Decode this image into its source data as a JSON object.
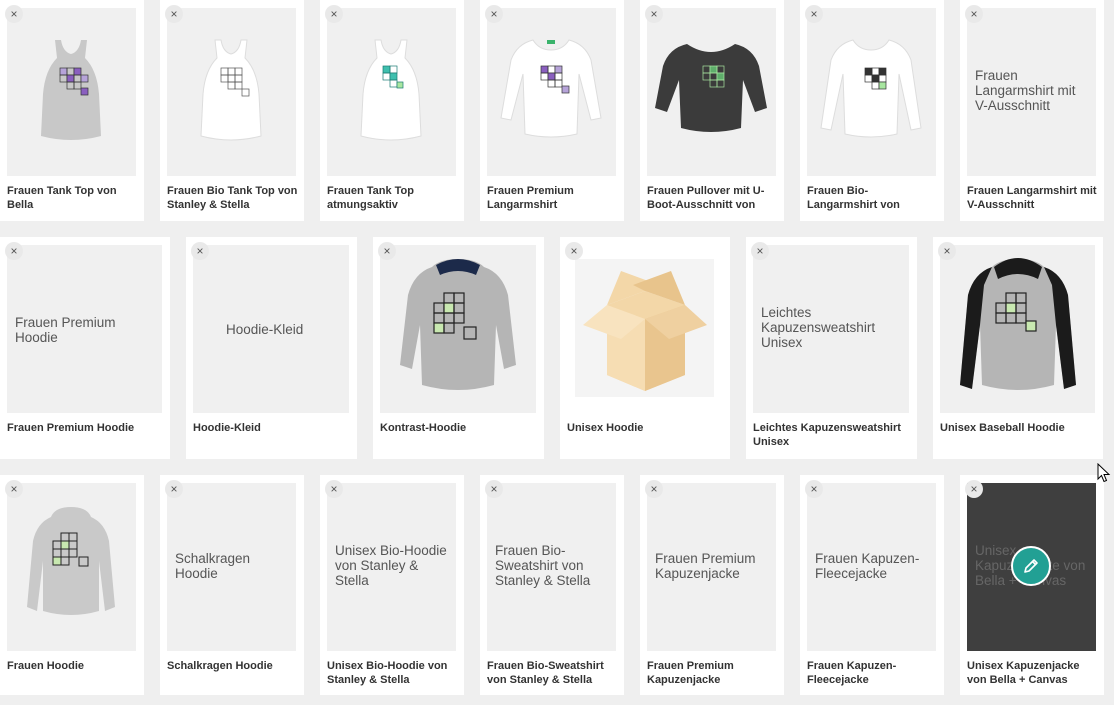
{
  "products": {
    "row1": [
      {
        "label": "Frauen Tank Top von Bella",
        "img": "tank-grey"
      },
      {
        "label": "Frauen Bio Tank Top von Stanley & Stella",
        "img": "tank-white"
      },
      {
        "label": "Frauen Tank Top atmungsaktiv",
        "img": "tank-white-teal"
      },
      {
        "label": "Frauen Premium Langarmshirt",
        "img": "longsleeve-white"
      },
      {
        "label": "Frauen Pullover mit U-Boot-Ausschnitt von",
        "img": "pullover-dark"
      },
      {
        "label": "Frauen Bio-Langarmshirt von",
        "img": "longsleeve-white-2"
      },
      {
        "label": "Frauen Langarmshirt mit V-Ausschnitt",
        "alt": "Frauen Langarmshirt mit V-Ausschnitt"
      }
    ],
    "row2": [
      {
        "label": "Frauen Premium Hoodie",
        "alt": "Frauen Premium Hoodie"
      },
      {
        "label": "Hoodie-Kleid",
        "alt": "Hoodie-Kleid"
      },
      {
        "label": "Kontrast-Hoodie",
        "img": "contrast-hoodie"
      },
      {
        "label": "Unisex Hoodie",
        "img": "box"
      },
      {
        "label": "Leichtes Kapuzensweatshirt Unisex",
        "alt": "Leichtes Kapuzensweatshirt Unisex"
      },
      {
        "label": "Unisex Baseball Hoodie",
        "img": "baseball-hoodie"
      }
    ],
    "row3": [
      {
        "label": "Frauen Hoodie",
        "img": "women-hoodie"
      },
      {
        "label": "Schalkragen Hoodie",
        "alt": "Schalkragen Hoodie"
      },
      {
        "label": "Unisex Bio-Hoodie von Stanley & Stella",
        "alt": "Unisex Bio-Hoodie von Stanley & Stella"
      },
      {
        "label": "Frauen Bio-Sweatshirt von Stanley & Stella",
        "alt": "Frauen Bio-Sweatshirt von Stanley & Stella"
      },
      {
        "label": "Frauen Premium Kapuzenjacke",
        "alt": "Frauen Premium Kapuzenjacke"
      },
      {
        "label": "Frauen Kapuzen-Fleecejacke",
        "alt": "Frauen Kapuzen-Fleecejacke"
      },
      {
        "label": "Unisex Kapuzenjacke von Bella + Canvas",
        "alt": "Unisex Kapuzenjacke von Bella + Canvas"
      }
    ]
  },
  "remove_symbol": "×",
  "colors": {
    "accent": "#22a094",
    "background": "#efefef",
    "placeholder": "#f0f0f0"
  }
}
